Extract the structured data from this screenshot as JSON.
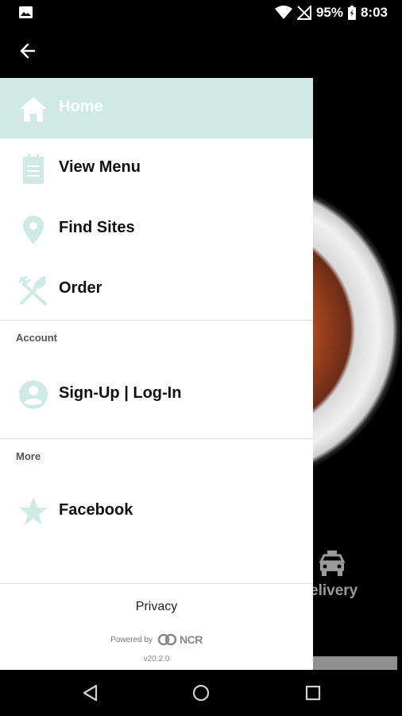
{
  "status_bar": {
    "battery": "95%",
    "time": "8:03"
  },
  "drawer": {
    "items": [
      {
        "label": "Home",
        "icon": "home-icon"
      },
      {
        "label": "View Menu",
        "icon": "menu-document-icon"
      },
      {
        "label": "Find Sites",
        "icon": "location-pin-icon"
      },
      {
        "label": "Order",
        "icon": "utensils-icon"
      }
    ],
    "account_header": "Account",
    "account_items": [
      {
        "label": "Sign-Up | Log-In",
        "icon": "person-icon"
      }
    ],
    "more_header": "More",
    "more_items": [
      {
        "label": "Facebook",
        "icon": "star-icon"
      }
    ],
    "footer": {
      "privacy": "Privacy",
      "powered_by": "Powered by",
      "brand": "NCR",
      "version": "v20.2.0"
    }
  },
  "background": {
    "delivery_label": "elivery"
  },
  "colors": {
    "accent": "#cfeae5",
    "icon_tint": "#bfe6df"
  }
}
